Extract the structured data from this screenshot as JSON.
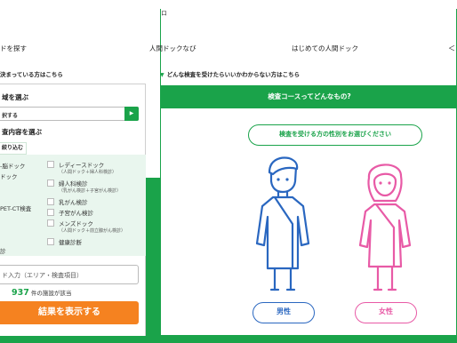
{
  "top": {
    "right_glyph": "ロ"
  },
  "nav": {
    "item1": "ドを探す",
    "item2": "人間ドックなび",
    "item3": "はじめての人間ドック",
    "arrow": "＜"
  },
  "left_heading": "決まっている方はこちら",
  "right_heading": "どんな検査を受けたらいいかわからない方はこちら",
  "search": {
    "area_label": "域を選ぶ",
    "area_select": "択する",
    "exam_label": "査内容を選ぶ",
    "filter_tab": "絞り込む",
    "left_partial": [
      "-脳ドック",
      "ドック",
      "PET-CT検査",
      "診"
    ],
    "checks": [
      {
        "label": "レディースドック",
        "sub": "（人間ドック＋婦人科検診）"
      },
      {
        "label": "婦人科検診",
        "sub": "（乳がん検診＋子宮がん検診）"
      },
      {
        "label": "乳がん検診",
        "sub": ""
      },
      {
        "label": "子宮がん検診",
        "sub": ""
      },
      {
        "label": "メンズドック",
        "sub": "（人間ドック＋前立腺がん検診）"
      },
      {
        "label": "健康診断",
        "sub": ""
      }
    ],
    "keyword_placeholder": "ド入力（エリア・検査項目）",
    "count_number": "937",
    "count_suffix": "件の施設が該当",
    "result_button": "結果を表示する"
  },
  "course": {
    "header": "検査コースってどんなもの?",
    "question": "検査を受ける方の性別をお選びください",
    "male": "男性",
    "female": "女性"
  },
  "colors": {
    "green": "#1aa34a",
    "orange": "#f58220",
    "male": "#2a67c0",
    "female": "#e85aa6",
    "filter_bg": "#e9f6ee"
  }
}
